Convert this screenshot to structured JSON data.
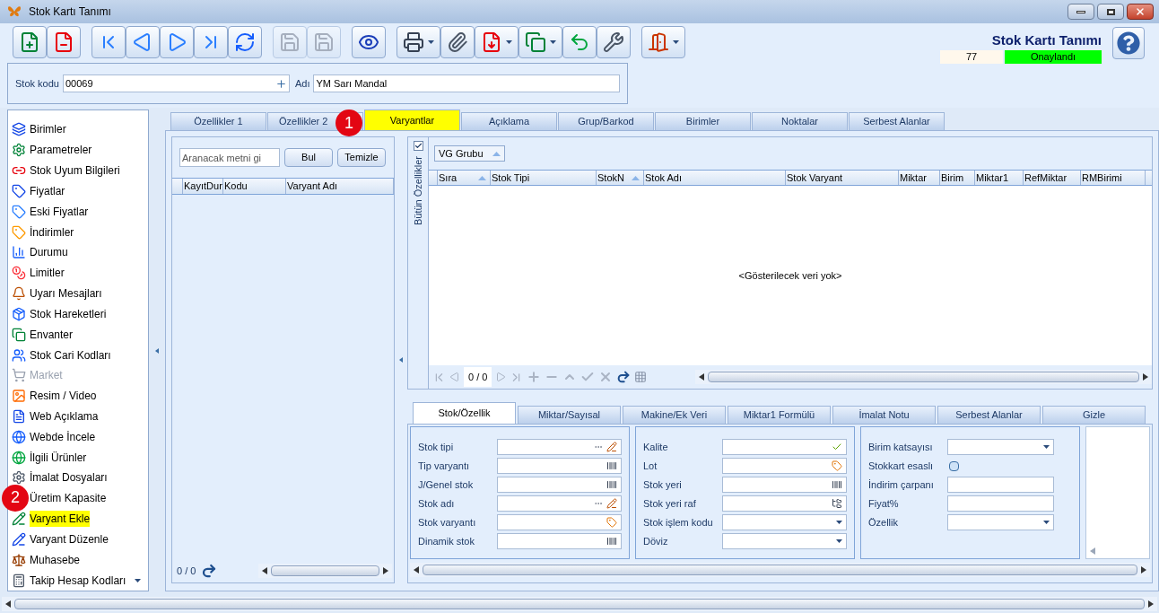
{
  "window": {
    "title": "Stok Kartı Tanımı"
  },
  "toolbar": [
    {
      "kind": "new",
      "disabled": false
    },
    {
      "kind": "delete",
      "disabled": false
    },
    {
      "kind": "first",
      "disabled": false
    },
    {
      "kind": "prev",
      "disabled": false
    },
    {
      "kind": "next",
      "disabled": false
    },
    {
      "kind": "last",
      "disabled": false
    },
    {
      "kind": "refresh",
      "disabled": false
    },
    {
      "kind": "save",
      "disabled": true
    },
    {
      "kind": "cancel",
      "disabled": true
    },
    {
      "kind": "preview",
      "disabled": false
    },
    {
      "kind": "print",
      "disabled": false
    },
    {
      "kind": "attach",
      "disabled": false
    },
    {
      "kind": "pdf",
      "disabled": false
    },
    {
      "kind": "export",
      "disabled": false
    },
    {
      "kind": "import",
      "disabled": false
    },
    {
      "kind": "tools",
      "disabled": false
    },
    {
      "kind": "exit",
      "disabled": false
    }
  ],
  "header": {
    "title": "Stok Kartı Tanımı",
    "number": "77",
    "status": "Onaylandı"
  },
  "stock": {
    "code_label": "Stok kodu",
    "code": "00069",
    "name_label": "Adı",
    "name": "YM Sarı Mandal"
  },
  "sidebar": {
    "items": [
      {
        "label": "Birimler",
        "disabled": false,
        "highlighted": false
      },
      {
        "label": "Parametreler",
        "disabled": false,
        "highlighted": false
      },
      {
        "label": "Stok Uyum Bilgileri",
        "disabled": false,
        "highlighted": false
      },
      {
        "label": "Fiyatlar",
        "disabled": false,
        "highlighted": false
      },
      {
        "label": "Eski Fiyatlar",
        "disabled": false,
        "highlighted": false
      },
      {
        "label": "İndirimler",
        "disabled": false,
        "highlighted": false
      },
      {
        "label": "Durumu",
        "disabled": false,
        "highlighted": false
      },
      {
        "label": "Limitler",
        "disabled": false,
        "highlighted": false
      },
      {
        "label": "Uyarı Mesajları",
        "disabled": false,
        "highlighted": false
      },
      {
        "label": "Stok Hareketleri",
        "disabled": false,
        "highlighted": false
      },
      {
        "label": "Envanter",
        "disabled": false,
        "highlighted": false
      },
      {
        "label": "Stok Cari Kodları",
        "disabled": false,
        "highlighted": false
      },
      {
        "label": "Market",
        "disabled": true,
        "highlighted": false
      },
      {
        "label": "Resim / Video",
        "disabled": false,
        "highlighted": false
      },
      {
        "label": "Web Açıklama",
        "disabled": false,
        "highlighted": false
      },
      {
        "label": "Webde İncele",
        "disabled": false,
        "highlighted": false
      },
      {
        "label": "İlgili Ürünler",
        "disabled": false,
        "highlighted": false
      },
      {
        "label": "İmalat Dosyaları",
        "disabled": false,
        "highlighted": false
      },
      {
        "label": "Üretim Kapasite",
        "disabled": false,
        "highlighted": false,
        "callout": "2"
      },
      {
        "label": "Varyant Ekle",
        "disabled": false,
        "highlighted": true
      },
      {
        "label": "Varyant Düzenle",
        "disabled": false,
        "highlighted": false
      },
      {
        "label": "Muhasebe",
        "disabled": false,
        "highlighted": false
      },
      {
        "label": "Takip Hesap Kodları",
        "disabled": false,
        "highlighted": false
      }
    ]
  },
  "tabs": [
    {
      "label": "Özellikler 1",
      "selected": false,
      "highlighted": false
    },
    {
      "label": "Özellikler 2",
      "selected": false,
      "highlighted": false,
      "callout": "1"
    },
    {
      "label": "Varyantlar",
      "selected": true,
      "highlighted": true
    },
    {
      "label": "Açıklama",
      "selected": false,
      "highlighted": false
    },
    {
      "label": "Grup/Barkod",
      "selected": false,
      "highlighted": false
    },
    {
      "label": "Birimler",
      "selected": false,
      "highlighted": false
    },
    {
      "label": "Noktalar",
      "selected": false,
      "highlighted": false
    },
    {
      "label": "Serbest Alanlar",
      "selected": false,
      "highlighted": false
    }
  ],
  "variant_list": {
    "search": {
      "placeholder": "Aranacak metni gi"
    },
    "buttons": [
      "Bul",
      "Temizle"
    ],
    "columns": [
      "KayıtDur",
      "Kodu",
      "Varyant Adı"
    ],
    "counter": "0 / 0"
  },
  "grid": {
    "show_all": {
      "label": "Bütün Özellikler",
      "checked": true
    },
    "group_chip": "VG Grubu",
    "columns": [
      {
        "label": "Sıra",
        "sorted": true
      },
      {
        "label": "Stok Tipi",
        "sorted": false
      },
      {
        "label": "StokN",
        "sorted": true
      },
      {
        "label": "Stok Adı",
        "sorted": false
      },
      {
        "label": "Stok Varyant",
        "sorted": false
      },
      {
        "label": "Miktar",
        "sorted": false
      },
      {
        "label": "Birim",
        "sorted": false
      },
      {
        "label": "Miktar1",
        "sorted": false
      },
      {
        "label": "RefMiktar",
        "sorted": false
      },
      {
        "label": "RMBirimi",
        "sorted": false
      }
    ],
    "empty_text": "<Gösterilecek veri yok>",
    "counter": "0 / 0"
  },
  "detail_tabs": [
    {
      "label": "Stok/Özellik",
      "selected": true
    },
    {
      "label": "Miktar/Sayısal",
      "selected": false
    },
    {
      "label": "Makine/Ek Veri",
      "selected": false
    },
    {
      "label": "Miktar1 Formülü",
      "selected": false
    },
    {
      "label": "İmalat Notu",
      "selected": false
    },
    {
      "label": "Serbest Alanlar",
      "selected": false
    },
    {
      "label": "Gizle",
      "selected": false
    }
  ],
  "detail_groups": [
    [
      {
        "label": "Stok tipi",
        "kind": "lookup"
      },
      {
        "label": "Tip varyantı",
        "kind": "barcode"
      },
      {
        "label": "J/Genel stok",
        "kind": "barcode"
      },
      {
        "label": "Stok adı",
        "kind": "lookup"
      },
      {
        "label": "Stok varyantı",
        "kind": "tag"
      },
      {
        "label": "Dinamik stok",
        "kind": "barcode"
      }
    ],
    [
      {
        "label": "Kalite",
        "kind": "check"
      },
      {
        "label": "Lot",
        "kind": "tag"
      },
      {
        "label": "Stok yeri",
        "kind": "barcode"
      },
      {
        "label": "Stok yeri raf",
        "kind": "tree"
      },
      {
        "label": "Stok işlem kodu",
        "kind": "dropdown"
      },
      {
        "label": "Döviz",
        "kind": "dropdown"
      }
    ],
    [
      {
        "label": "Birim katsayısı",
        "kind": "dropdown"
      },
      {
        "label": "Stokkart esaslı",
        "kind": "toggle",
        "checked": false
      },
      {
        "label": "İndirim çarpanı",
        "kind": "text"
      },
      {
        "label": "Fiyat%",
        "kind": "text"
      },
      {
        "label": "Özellik",
        "kind": "dropdown"
      }
    ]
  ]
}
